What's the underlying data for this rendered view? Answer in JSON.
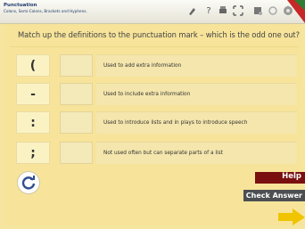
{
  "header": {
    "title": "Punctuation",
    "subtitle": "Colons, Semi-Colons, Brackets and Hyphens.",
    "tools": [
      {
        "icon": "pointer-icon"
      },
      {
        "icon": "help-icon",
        "glyph": "?"
      },
      {
        "icon": "print-icon"
      },
      {
        "icon": "fullscreen-icon"
      },
      {
        "icon": "teacher-icon"
      },
      {
        "icon": "circle-icon"
      },
      {
        "icon": "settings-icon"
      }
    ]
  },
  "activity": {
    "instruction": "Match up the definitions to the punctuation mark – which is the odd one out?",
    "rows": [
      {
        "symbol": "(",
        "definition": "Used to add extra information"
      },
      {
        "symbol": "-",
        "definition": "Used to include extra information"
      },
      {
        "symbol": ":",
        "definition": "Used to introduce lists and in plays to introduce speech"
      },
      {
        "symbol": ";",
        "definition": "Not used often but can separate parts of a list"
      }
    ]
  },
  "buttons": {
    "help": "Help",
    "check": "Check Answer"
  },
  "colors": {
    "panel": "#f7e49a",
    "help": "#7a0f10",
    "check": "#4c4f52",
    "arrow": "#f0c400",
    "accent": "#1f3a6e"
  }
}
